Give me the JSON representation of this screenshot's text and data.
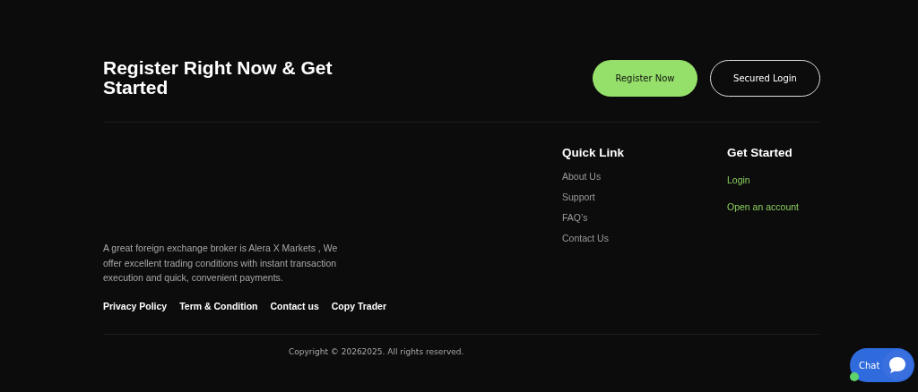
{
  "cta": {
    "title": "Register Right Now & Get Started",
    "buttons": [
      {
        "label": "Register Now",
        "kind": "primary"
      },
      {
        "label": "Secured Login",
        "kind": "outline"
      }
    ]
  },
  "about": {
    "text": "A great foreign exchange broker is Alera X Markets , We offer excellent trading conditions with instant transaction execution and quick, convenient payments.",
    "links": [
      "Privacy Policy",
      "Term & Condition",
      "Contact us",
      "Copy Trader"
    ]
  },
  "quick_link": {
    "title": "Quick Link",
    "items": [
      "About Us",
      "Support",
      "FAQ’s",
      "Contact Us"
    ]
  },
  "get_started": {
    "title": "Get Started",
    "items": [
      "Login",
      "Open an account"
    ]
  },
  "copyright": "Copyright © 20262025. All rights reserved.",
  "chat": {
    "label": "Chat",
    "online": true
  }
}
